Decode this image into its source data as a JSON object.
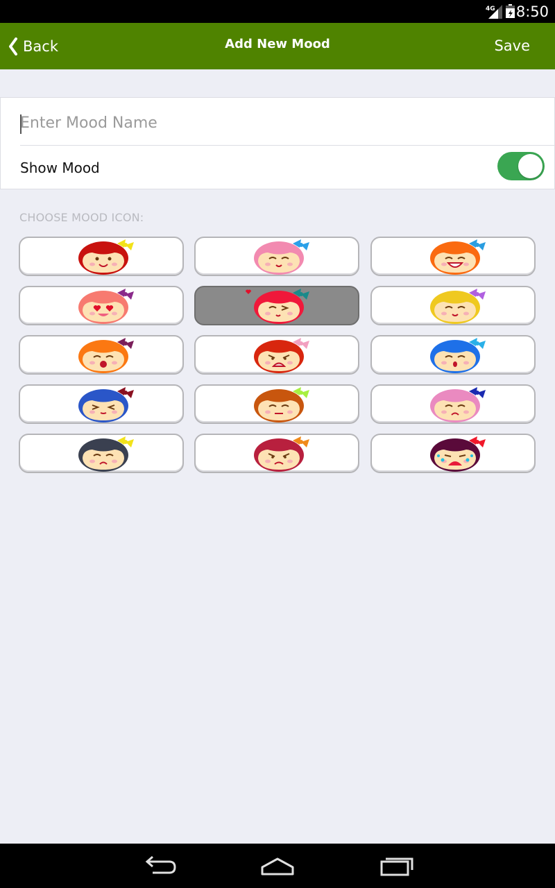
{
  "status_bar": {
    "time": "8:50",
    "network": "4G"
  },
  "header": {
    "back_label": "Back",
    "title": "Add New Mood",
    "save_label": "Save"
  },
  "form": {
    "name_placeholder": "Enter Mood Name",
    "name_value": "",
    "show_mood_label": "Show Mood",
    "show_mood_on": true
  },
  "section_label": "CHOOSE MOOD ICON:",
  "selected_icon_index": 4,
  "mood_icons": [
    {
      "name": "happy-red-icon",
      "hair": "#c8120e",
      "bow": "#f2e21a",
      "expr": "smile"
    },
    {
      "name": "content-pink-icon",
      "hair": "#f28ab0",
      "bow": "#2aa0e8",
      "expr": "closed-smile"
    },
    {
      "name": "laughing-orange-icon",
      "hair": "#fa6a10",
      "bow": "#2a9de0",
      "expr": "grin"
    },
    {
      "name": "in-love-salmon-icon",
      "hair": "#f77a70",
      "bow": "#8a2a8a",
      "expr": "heart-eyes"
    },
    {
      "name": "flirty-crimson-icon",
      "hair": "#f0183a",
      "bow": "#1a8a8a",
      "expr": "wink"
    },
    {
      "name": "cheerful-yellow-icon",
      "hair": "#efc920",
      "bow": "#b060e0",
      "expr": "closed-smile"
    },
    {
      "name": "surprised-orange-icon",
      "hair": "#fb7812",
      "bow": "#7a1e5a",
      "expr": "surprised"
    },
    {
      "name": "angry-red-icon",
      "hair": "#d8260e",
      "bow": "#f2a0c0",
      "expr": "angry"
    },
    {
      "name": "shocked-blue-icon",
      "hair": "#1e70e8",
      "bow": "#2ab0e8",
      "expr": "shocked"
    },
    {
      "name": "shy-blue-icon",
      "hair": "#2a56c8",
      "bow": "#8a1020",
      "expr": "shy"
    },
    {
      "name": "unimpressed-brown-icon",
      "hair": "#c8560e",
      "bow": "#a8f040",
      "expr": "flat"
    },
    {
      "name": "worried-pink-icon",
      "hair": "#ea8ac0",
      "bow": "#1a2ab0",
      "expr": "worried"
    },
    {
      "name": "sad-navy-icon",
      "hair": "#3a4050",
      "bow": "#f2e21a",
      "expr": "sad"
    },
    {
      "name": "annoyed-rose-icon",
      "hair": "#b8203e",
      "bow": "#f08a1a",
      "expr": "annoyed"
    },
    {
      "name": "crying-plum-icon",
      "hair": "#5a0a3a",
      "bow": "#f0182a",
      "expr": "crying"
    }
  ]
}
